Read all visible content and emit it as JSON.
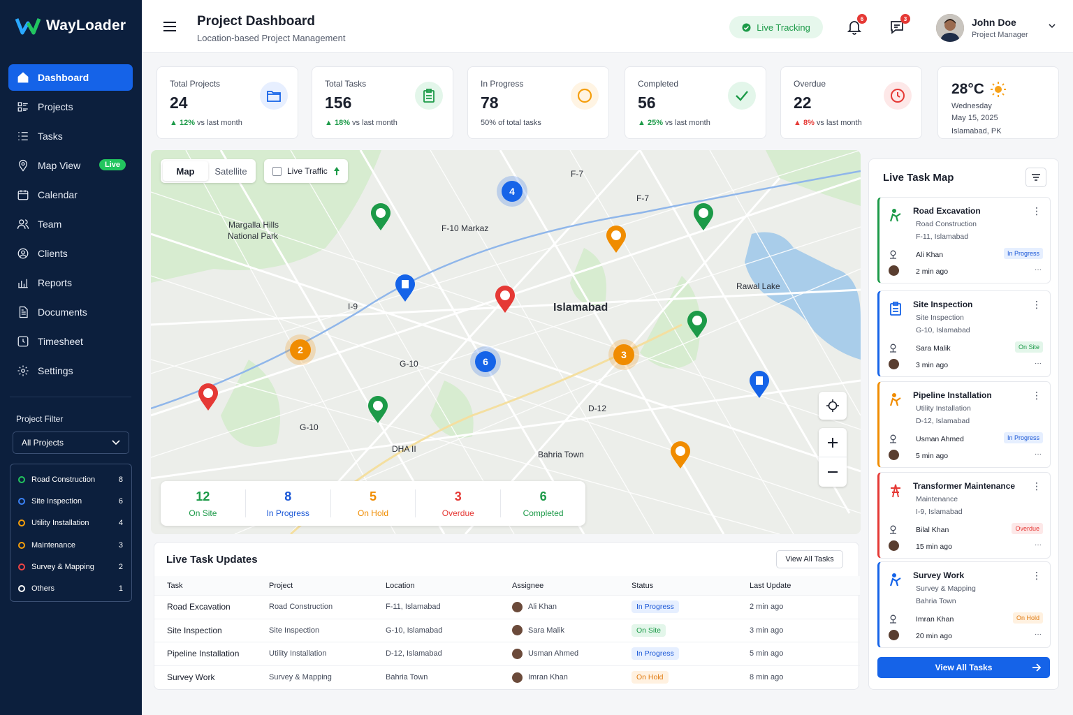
{
  "app": {
    "name": "WayLoader"
  },
  "sidebar": {
    "items": [
      {
        "label": "Dashboard",
        "icon": "home-icon",
        "active": true
      },
      {
        "label": "Projects",
        "icon": "projects-icon"
      },
      {
        "label": "Tasks",
        "icon": "tasks-icon"
      },
      {
        "label": "Map View",
        "icon": "map-pin-icon",
        "badge": "Live"
      },
      {
        "label": "Calendar",
        "icon": "calendar-icon"
      },
      {
        "label": "Team",
        "icon": "team-icon"
      },
      {
        "label": "Clients",
        "icon": "clients-icon"
      },
      {
        "label": "Reports",
        "icon": "reports-icon"
      },
      {
        "label": "Documents",
        "icon": "documents-icon"
      },
      {
        "label": "Timesheet",
        "icon": "timesheet-icon"
      },
      {
        "label": "Settings",
        "icon": "settings-icon"
      }
    ],
    "project_filter": {
      "title": "Project Filter",
      "selected": "All Projects",
      "items": [
        {
          "label": "Road Construction",
          "count": "8",
          "color": "#22c55e"
        },
        {
          "label": "Site Inspection",
          "count": "6",
          "color": "#3b82f6"
        },
        {
          "label": "Utility Installation",
          "count": "4",
          "color": "#f59e0b"
        },
        {
          "label": "Maintenance",
          "count": "3",
          "color": "#f59e0b"
        },
        {
          "label": "Survey & Mapping",
          "count": "2",
          "color": "#ef4444"
        },
        {
          "label": "Others",
          "count": "1",
          "color": "#ffffff"
        }
      ]
    }
  },
  "header": {
    "title": "Project Dashboard",
    "subtitle": "Location-based Project Management",
    "live_tracking": "Live Tracking",
    "notifications": "6",
    "messages": "3",
    "user": {
      "name": "John Doe",
      "role": "Project Manager"
    }
  },
  "stats": [
    {
      "label": "Total Projects",
      "value": "24",
      "trend": "12%",
      "trend_text": "vs last month",
      "dir": "up",
      "color": "#1563e8",
      "bg": "#e7efff"
    },
    {
      "label": "Total Tasks",
      "value": "156",
      "trend": "18%",
      "trend_text": "vs last month",
      "dir": "up",
      "color": "#1c9a48",
      "bg": "#e3f6ea"
    },
    {
      "label": "In Progress",
      "value": "78",
      "trend": "",
      "trend_text": "50% of total tasks",
      "dir": "none",
      "color": "#f59e0b",
      "bg": "#fff4e3"
    },
    {
      "label": "Completed",
      "value": "56",
      "trend": "25%",
      "trend_text": "vs last month",
      "dir": "up",
      "color": "#1c9a48",
      "bg": "#e3f6ea"
    },
    {
      "label": "Overdue",
      "value": "22",
      "trend": "8%",
      "trend_text": "vs last month",
      "dir": "down",
      "color": "#e53935",
      "bg": "#fde8e8"
    }
  ],
  "weather": {
    "temp": "28°C",
    "day": "Wednesday",
    "date": "May 15, 2025",
    "location": "Islamabad, PK"
  },
  "map": {
    "tabs": [
      "Map",
      "Satellite"
    ],
    "live_traffic": "Live Traffic",
    "labels": [
      {
        "text": "F-7"
      },
      {
        "text": "F-7"
      },
      {
        "text": "Margalla Hills"
      },
      {
        "text": "National Park"
      },
      {
        "text": "F-10 Markaz"
      },
      {
        "text": "Rawal Lake"
      },
      {
        "text": "I-9"
      },
      {
        "text": "Islamabad"
      },
      {
        "text": "G-10"
      },
      {
        "text": "D-12"
      },
      {
        "text": "G-10"
      },
      {
        "text": "DHA II"
      },
      {
        "text": "Bahria Town"
      }
    ],
    "clusters": [
      "4",
      "2",
      "6",
      "3"
    ],
    "summary": [
      {
        "value": "12",
        "label": "On Site",
        "color": "#1c9a48"
      },
      {
        "value": "8",
        "label": "In Progress",
        "color": "#1a57d6"
      },
      {
        "value": "5",
        "label": "On Hold",
        "color": "#f08c00"
      },
      {
        "value": "3",
        "label": "Overdue",
        "color": "#e53935"
      },
      {
        "value": "6",
        "label": "Completed",
        "color": "#1c9a48"
      }
    ]
  },
  "updates": {
    "title": "Live Task Updates",
    "view_all": "View All Tasks",
    "columns": [
      "Task",
      "Project",
      "Location",
      "Assignee",
      "Status",
      "Last Update"
    ],
    "rows": [
      {
        "task": "Road Excavation",
        "project": "Road Construction",
        "location": "F-11, Islamabad",
        "assignee": "Ali Khan",
        "status": "In Progress",
        "time": "2 min ago"
      },
      {
        "task": "Site Inspection",
        "project": "Site Inspection",
        "location": "G-10, Islamabad",
        "assignee": "Sara Malik",
        "status": "On Site",
        "time": "3 min ago"
      },
      {
        "task": "Pipeline Installation",
        "project": "Utility Installation",
        "location": "D-12, Islamabad",
        "assignee": "Usman Ahmed",
        "status": "In Progress",
        "time": "5 min ago"
      },
      {
        "task": "Survey Work",
        "project": "Survey & Mapping",
        "location": "Bahria Town",
        "assignee": "Imran Khan",
        "status": "On Hold",
        "time": "8 min ago"
      }
    ]
  },
  "panel": {
    "title": "Live Task Map",
    "button": "View All Tasks",
    "cards": [
      {
        "title": "Road Excavation",
        "project": "Road Construction",
        "location": "F-11, Islamabad",
        "assignee": "Ali Khan",
        "status": "In Progress",
        "time": "2 min ago",
        "color": "#1c9a48"
      },
      {
        "title": "Site Inspection",
        "project": "Site Inspection",
        "location": "G-10, Islamabad",
        "assignee": "Sara Malik",
        "status": "On Site",
        "time": "3 min ago",
        "color": "#1563e8"
      },
      {
        "title": "Pipeline Installation",
        "project": "Utility Installation",
        "location": "D-12, Islamabad",
        "assignee": "Usman Ahmed",
        "status": "In Progress",
        "time": "5 min ago",
        "color": "#f08c00"
      },
      {
        "title": "Transformer Maintenance",
        "project": "Maintenance",
        "location": "I-9, Islamabad",
        "assignee": "Bilal Khan",
        "status": "Overdue",
        "time": "15 min ago",
        "color": "#e53935"
      },
      {
        "title": "Survey Work",
        "project": "Survey & Mapping",
        "location": "Bahria Town",
        "assignee": "Imran Khan",
        "status": "On Hold",
        "time": "20 min ago",
        "color": "#1563e8"
      }
    ]
  }
}
